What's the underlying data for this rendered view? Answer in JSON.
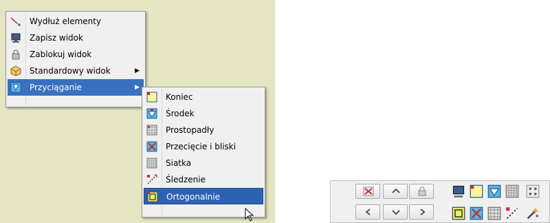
{
  "main_menu": {
    "items": [
      {
        "label": "Wydłuż elementy",
        "icon": "extend-icon"
      },
      {
        "label": "Zapisz widok",
        "icon": "monitor-icon"
      },
      {
        "label": "Zablokuj widok",
        "icon": "lock-icon"
      },
      {
        "label": "Standardowy widok",
        "icon": "cube-view-icon"
      },
      {
        "label": "Przyciąganie",
        "icon": "snap-icon"
      }
    ]
  },
  "sub_menu": {
    "items": [
      {
        "label": "Koniec",
        "icon": "snap-end-icon"
      },
      {
        "label": "Środek",
        "icon": "snap-middle-icon"
      },
      {
        "label": "Prostopadły",
        "icon": "snap-perpendicular-icon"
      },
      {
        "label": "Przecięcie i bliski",
        "icon": "snap-intersection-icon"
      },
      {
        "label": "Siatka",
        "icon": "grid-icon"
      },
      {
        "label": "Śledzenie",
        "icon": "tracking-icon"
      },
      {
        "label": "Ortogonalnie",
        "icon": "orthogonal-icon"
      }
    ]
  },
  "colors": {
    "canvas": "#e6e5c3",
    "menu_bg": "#f0f0f0",
    "highlight": "#3a70c0"
  }
}
